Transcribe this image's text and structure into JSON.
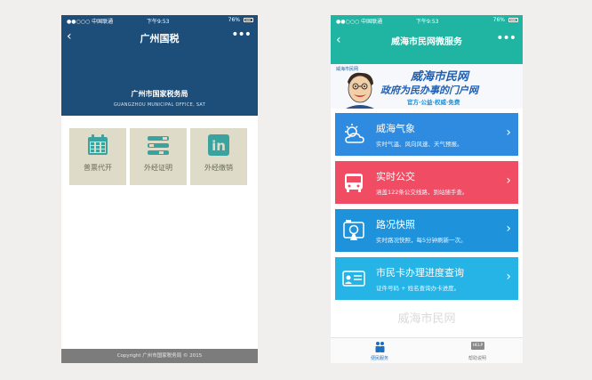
{
  "left_phone": {
    "status": {
      "carrier": "●●○○○ 中国联通 ",
      "time": "下午9:53",
      "battery": "76%"
    },
    "nav": {
      "title": "广州国税",
      "back": "‹",
      "more": "•••"
    },
    "header": {
      "title": "广州市国家税务局",
      "subtitle": "GUANGZHOU MUNICIPAL OFFICE, SAT"
    },
    "tiles": [
      {
        "label": "普票代开",
        "icon": "calendar-icon"
      },
      {
        "label": "外经证明",
        "icon": "list-icon"
      },
      {
        "label": "外经缴销",
        "icon": "linkedin-icon",
        "icon_text": "in"
      }
    ],
    "footer": "Copyright 广州市国家税务局 © 2015"
  },
  "right_phone": {
    "status": {
      "carrier": "●●○○○ 中国联通 ",
      "time": "下午9:53",
      "battery": "76%"
    },
    "nav": {
      "title": "威海市民网微服务",
      "back": "‹",
      "more": "•••"
    },
    "banner": {
      "logo_text": "威海市民网",
      "title": "威海市民网",
      "slogan": "政府为民办事的门户网",
      "tagline": "官方·公益·权威·免费"
    },
    "cards": [
      {
        "title": "威海气象",
        "desc": "实时气温、风向风速、天气预报。",
        "color": "#2f8bdf",
        "icon": "weather-icon"
      },
      {
        "title": "实时公交",
        "desc": "涵盖122条公交线路，到站随手查。",
        "color": "#f04c63",
        "icon": "bus-icon"
      },
      {
        "title": "路况快照",
        "desc": "实时路况快照，每5分钟刷新一次。",
        "color": "#1e93dc",
        "icon": "road-camera-icon"
      },
      {
        "title": "市民卡办理进度查询",
        "desc": "证件号码 + 姓名查询办卡进度。",
        "color": "#26b3e6",
        "icon": "id-card-icon"
      }
    ],
    "watermark": "威海市民网",
    "tabs": [
      {
        "label": "便民服务",
        "icon": "people-icon",
        "active": true
      },
      {
        "label": "帮助说明",
        "icon": "help-icon",
        "icon_text": "HELP",
        "active": false
      }
    ]
  },
  "colors": {
    "left_header": "#1d4e7a",
    "tile_bg": "#dedcc8",
    "tile_icon": "#3aa3a0",
    "right_header": "#1fb5a2"
  }
}
